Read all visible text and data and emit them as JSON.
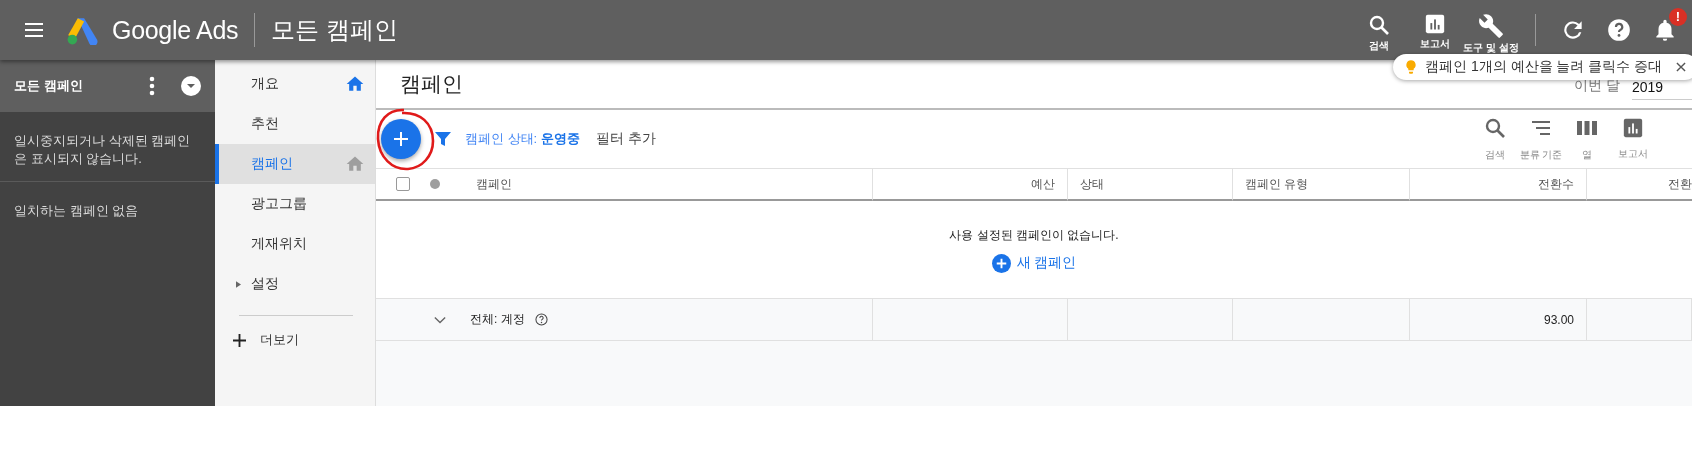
{
  "topbar": {
    "product": "Google Ads",
    "page_title": "모든 캠페인",
    "actions": [
      {
        "label": "검색",
        "kind": "search"
      },
      {
        "label": "보고서",
        "kind": "reports"
      },
      {
        "label": "도구 및 설정",
        "kind": "tools"
      }
    ],
    "notification_badge": "!"
  },
  "tip": {
    "text": "캠페인 1개의 예산을 늘려 클릭수 증대"
  },
  "sidebar": {
    "title": "모든 캠페인",
    "note": "일시중지되거나 삭제된 캠페인은 표시되지 않습니다.",
    "empty": "일치하는 캠페인 없음"
  },
  "nav": {
    "items": [
      {
        "label": "개요",
        "kind": "home",
        "selected": false
      },
      {
        "label": "추천",
        "kind": "plain",
        "selected": false
      },
      {
        "label": "캠페인",
        "kind": "home-option",
        "selected": true
      },
      {
        "label": "광고그룹",
        "kind": "plain",
        "selected": false
      },
      {
        "label": "게재위치",
        "kind": "plain",
        "selected": false
      },
      {
        "label": "설정",
        "kind": "expandable",
        "selected": false
      }
    ],
    "more": "더보기"
  },
  "main": {
    "title": "캠페인",
    "date_label": "이번 달",
    "date_value": "2019",
    "filter": "캠페인 상태: **운영중**",
    "add_filter": "필터 추가",
    "tools": [
      {
        "label": "검색",
        "kind": "search"
      },
      {
        "label": "분류 기준",
        "kind": "sort"
      },
      {
        "label": "열",
        "kind": "columns"
      },
      {
        "label": "보고서",
        "kind": "reports"
      }
    ],
    "table": {
      "select_all_checked": false,
      "columns": [
        "캠페인",
        "예산",
        "상태",
        "캠페인 유형",
        "전환수",
        "전환"
      ],
      "empty_message": "사용 설정된 캠페인이 없습니다.",
      "new_campaign": "새 캠페인",
      "total_row": {
        "label": "전체: 계정",
        "conversions": "93.00"
      }
    }
  }
}
